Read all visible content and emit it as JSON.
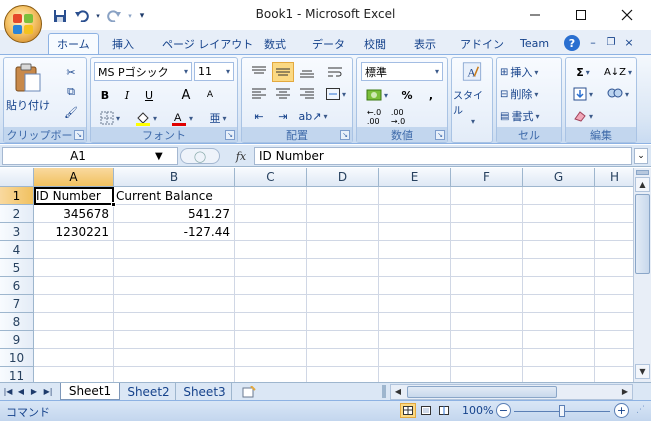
{
  "window": {
    "title": "Book1 - Microsoft Excel",
    "minimize": "–",
    "maximize": "□",
    "close": "✕"
  },
  "quick_access": {
    "save_icon": "save-icon",
    "undo_icon": "undo-icon",
    "redo_icon": "redo-icon",
    "customize_icon": "customize-icon"
  },
  "ribbon_tabs": [
    "ホーム",
    "挿入",
    "ページ レイアウト",
    "数式",
    "データ",
    "校閲",
    "表示",
    "アドイン",
    "Team"
  ],
  "ribbon_tab_active": 0,
  "ribbon": {
    "clipboard": {
      "paste_label": "貼り付け",
      "group_label": "クリップボード"
    },
    "font": {
      "font_name": "MS Pゴシック",
      "font_size": "11",
      "bold": "B",
      "italic": "I",
      "underline": "U",
      "grow": "A",
      "shrink": "A",
      "group_label": "フォント"
    },
    "alignment": {
      "group_label": "配置"
    },
    "number": {
      "format": "標準",
      "percent": "%",
      "comma": ",",
      "group_label": "数値"
    },
    "style": {
      "label": "スタイル"
    },
    "cells": {
      "insert": "挿入",
      "delete": "削除",
      "format": "書式",
      "group_label": "セル"
    },
    "editing": {
      "sum": "Σ",
      "group_label": "編集"
    }
  },
  "formula_bar": {
    "name_box": "A1",
    "fx": "fx",
    "value": "ID Number"
  },
  "columns": [
    "A",
    "B",
    "C",
    "D",
    "E",
    "F",
    "G",
    "H"
  ],
  "rows": [
    "1",
    "2",
    "3",
    "4",
    "5",
    "6",
    "7",
    "8",
    "9",
    "10",
    "11"
  ],
  "cells": {
    "A1": "ID Number",
    "B1": "Current Balance",
    "A2": "345678",
    "B2": "541.27",
    "A3": "1230221",
    "B3": "-127.44"
  },
  "sheets": [
    "Sheet1",
    "Sheet2",
    "Sheet3"
  ],
  "active_sheet": 0,
  "status": {
    "mode": "コマンド",
    "zoom": "100%"
  },
  "colors": {
    "ribbon_blue": "#dbe7f5",
    "header_selected": "#f1c15f",
    "text_blue": "#15428b"
  }
}
